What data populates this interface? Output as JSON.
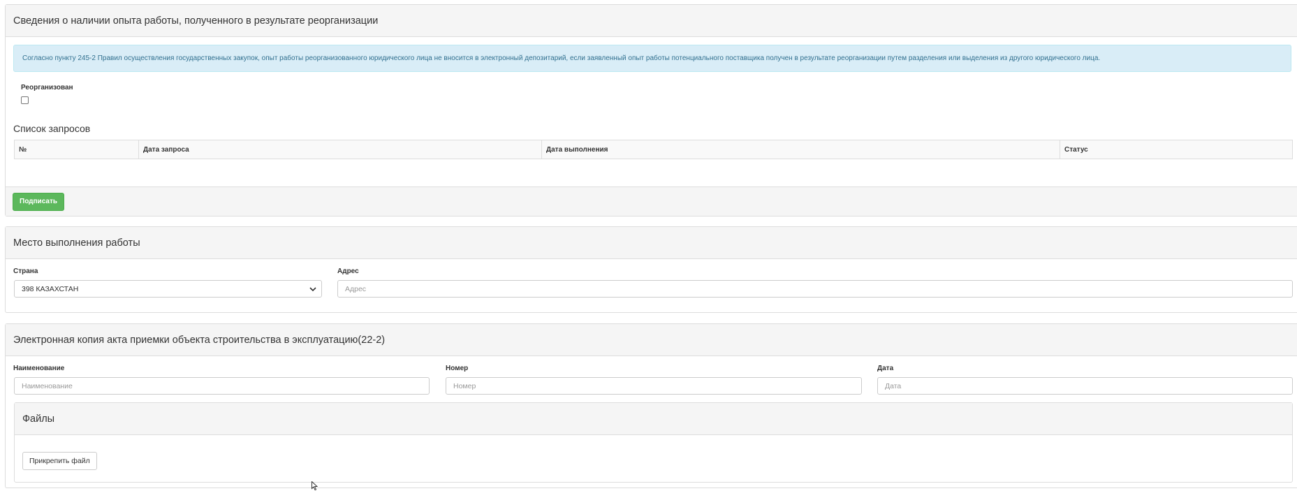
{
  "reorg_panel": {
    "title": "Сведения о наличии опыта работы, полученного в результате реорганизации",
    "info_text": "Согласно пункту 245-2 Правил осуществления государственных закупок, опыт работы реорганизованного юридического лица не вносится в электронный депозитарий, если заявленный опыт работы потенциального поставщика получен в результате реорганизации путем разделения или выделения из другого юридического лица.",
    "reorganized_label": "Реорганизован",
    "reorganized_checked": false,
    "requests_title": "Список запросов",
    "table_headers": [
      "№",
      "Дата запроса",
      "Дата выполнения",
      "Статус"
    ],
    "sign_button": "Подписать"
  },
  "place_panel": {
    "title": "Место выполнения работы",
    "country_label": "Страна",
    "country_value": "398 КАЗАХСТАН",
    "address_label": "Адрес",
    "address_placeholder": "Адрес"
  },
  "act_panel": {
    "title": "Электронная копия акта приемки объекта строительства в эксплуатацию(22-2)",
    "name_label": "Наименование",
    "name_placeholder": "Наименование",
    "number_label": "Номер",
    "number_placeholder": "Номер",
    "date_label": "Дата",
    "date_placeholder": "Дата",
    "files_title": "Файлы",
    "attach_button": "Прикрепить файл"
  },
  "colors": {
    "success": "#5cb85c",
    "info_bg": "#d9edf7",
    "info_text": "#31708f",
    "panel_heading": "#f5f5f5"
  }
}
